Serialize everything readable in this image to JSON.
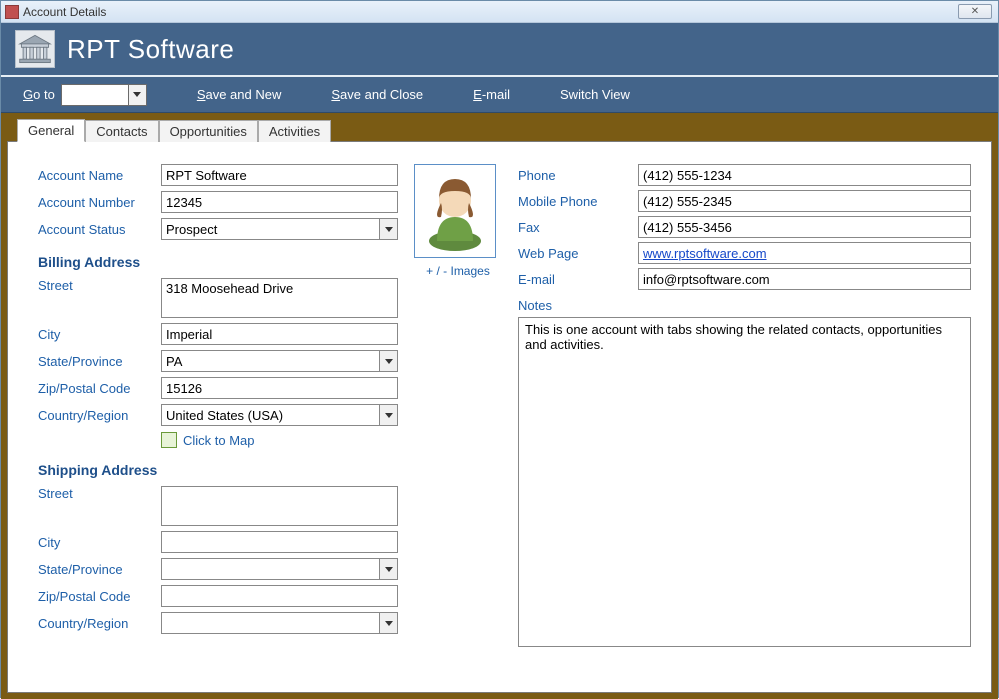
{
  "window": {
    "title": "Account Details"
  },
  "header": {
    "app_title": "RPT Software"
  },
  "toolbar": {
    "goto_label": "Go to",
    "goto_value": "",
    "save_new": "Save and New",
    "save_close": "Save and Close",
    "email": "E-mail",
    "switch_view": "Switch View"
  },
  "tabs": [
    {
      "label": "General",
      "active": true
    },
    {
      "label": "Contacts",
      "active": false
    },
    {
      "label": "Opportunities",
      "active": false
    },
    {
      "label": "Activities",
      "active": false
    }
  ],
  "left": {
    "account_name_label": "Account Name",
    "account_name": "RPT Software",
    "account_number_label": "Account Number",
    "account_number": "12345",
    "account_status_label": "Account Status",
    "account_status": "Prospect",
    "billing_heading": "Billing Address",
    "billing": {
      "street_label": "Street",
      "street": "318 Moosehead Drive",
      "city_label": "City",
      "city": "Imperial",
      "state_label": "State/Province",
      "state": "PA",
      "zip_label": "Zip/Postal Code",
      "zip": "15126",
      "country_label": "Country/Region",
      "country": "United States (USA)"
    },
    "map_link": "Click to Map",
    "shipping_heading": "Shipping Address",
    "shipping": {
      "street_label": "Street",
      "street": "",
      "city_label": "City",
      "city": "",
      "state_label": "State/Province",
      "state": "",
      "zip_label": "Zip/Postal Code",
      "zip": "",
      "country_label": "Country/Region",
      "country": ""
    }
  },
  "mid": {
    "images_toggle": "+ / -  Images"
  },
  "right": {
    "phone_label": "Phone",
    "phone": "(412) 555-1234",
    "mobile_label": "Mobile Phone",
    "mobile": "(412) 555-2345",
    "fax_label": "Fax",
    "fax": "(412) 555-3456",
    "web_label": "Web Page",
    "web": "www.rptsoftware.com",
    "email_label": "E-mail",
    "email": "info@rptsoftware.com",
    "notes_label": "Notes",
    "notes": "This is one account with tabs showing the related contacts, opportunities and activities."
  }
}
